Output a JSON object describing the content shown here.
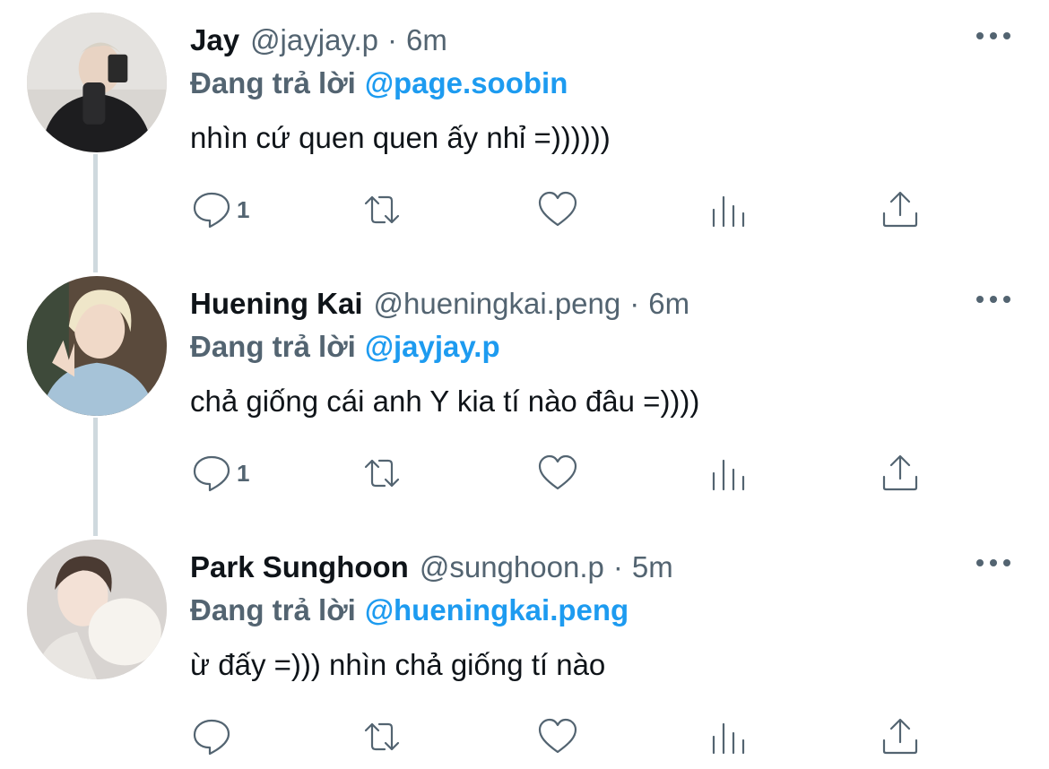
{
  "tweets": [
    {
      "name": "Jay",
      "handle": "@jayjay.p",
      "separator": "·",
      "time": "6m",
      "reply_label": "Đang trả lời",
      "reply_to": "@page.soobin",
      "text": "nhìn cứ quen quen ấy nhỉ =))))))",
      "reply_count": "1",
      "retweet_count": "",
      "like_count": ""
    },
    {
      "name": "Huening Kai",
      "handle": "@hueningkai.peng",
      "separator": "·",
      "time": "6m",
      "reply_label": "Đang trả lời",
      "reply_to": "@jayjay.p",
      "text": "chả giống cái anh Y kia tí nào đâu =))))",
      "reply_count": "1",
      "retweet_count": "",
      "like_count": ""
    },
    {
      "name": "Park Sunghoon",
      "handle": "@sunghoon.p",
      "separator": "·",
      "time": "5m",
      "reply_label": "Đang trả lời",
      "reply_to": "@hueningkai.peng",
      "text": "ừ đấy =))) nhìn chả giống tí nào",
      "reply_count": "",
      "retweet_count": "",
      "like_count": ""
    }
  ],
  "icons": {
    "reply": "speech-bubble-icon",
    "retweet": "retweet-arrows-icon",
    "like": "heart-icon",
    "views": "bar-chart-icon",
    "share": "share-upload-icon",
    "more": "more-dots-icon"
  },
  "colors": {
    "text_primary": "#0f1419",
    "text_secondary": "#536471",
    "link": "#1d9bf0",
    "thread_line": "#cfd9de"
  }
}
